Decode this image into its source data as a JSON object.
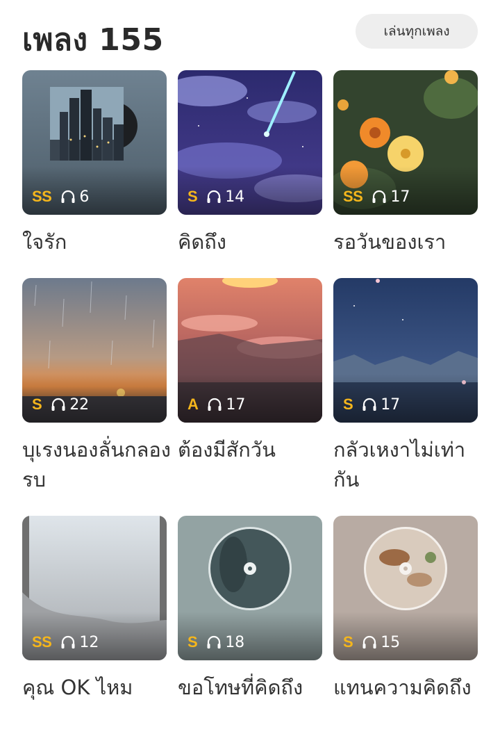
{
  "header": {
    "title": "เพลง 155",
    "play_all_label": "เล่นทุกเพลง"
  },
  "colors": {
    "grade": "#f5b61c",
    "play_count": "#ffffff",
    "title_text": "#333333"
  },
  "songs": [
    {
      "title": "ใจรัก",
      "grade": "SS",
      "plays": "6",
      "art": "city-vinyl-cover"
    },
    {
      "title": "คิดถึง",
      "grade": "S",
      "plays": "14",
      "art": "night-sky-comet"
    },
    {
      "title": "รอวันของเรา",
      "grade": "SS",
      "plays": "17",
      "art": "orange-flowers"
    },
    {
      "title": "บุเรงนองลั่นกลองรบ",
      "grade": "S",
      "plays": "22",
      "art": "rainy-sunset"
    },
    {
      "title": "ต้องมีสักวัน",
      "grade": "A",
      "plays": "17",
      "art": "pink-clouds-sunset"
    },
    {
      "title": "กลัวเหงาไม่เท่ากัน",
      "grade": "S",
      "plays": "17",
      "art": "night-lake-mountains"
    },
    {
      "title": "คุณ OK ไหม",
      "grade": "SS",
      "plays": "12",
      "art": "misty-window"
    },
    {
      "title": "ขอโทษที่คิดถึง",
      "grade": "S",
      "plays": "18",
      "art": "rain-disc"
    },
    {
      "title": "แทนความคิดถึง",
      "grade": "S",
      "plays": "15",
      "art": "picnic-disc"
    }
  ]
}
